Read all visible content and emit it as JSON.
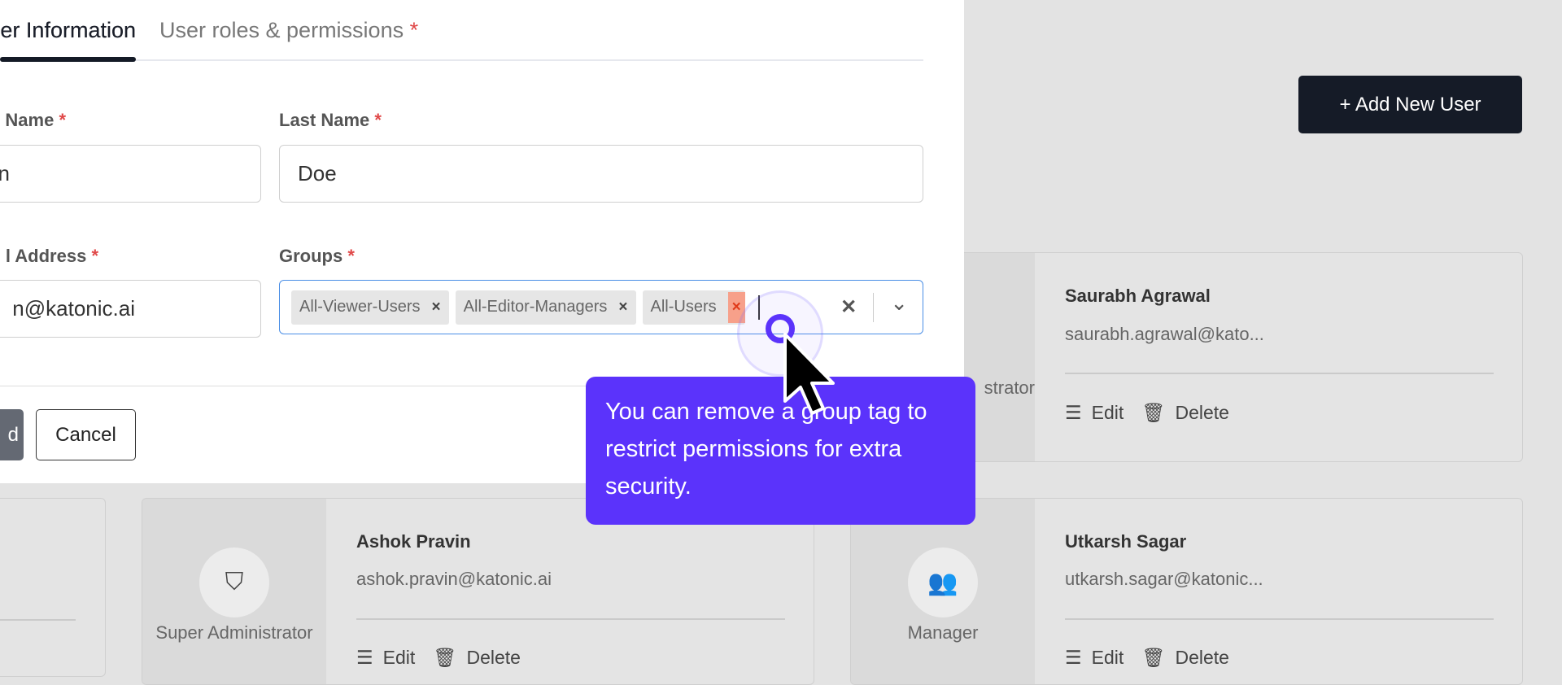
{
  "modal": {
    "tabs": [
      {
        "label": "User Information",
        "visible_label": "er Information"
      },
      {
        "label": "User roles & permissions",
        "required": "*"
      }
    ],
    "fields": {
      "first_name": {
        "label": "Name",
        "required": "*",
        "value": "hn"
      },
      "last_name": {
        "label": "Last Name",
        "required": "*",
        "value": "Doe"
      },
      "email": {
        "label": "l Address",
        "required": "*",
        "value": "n@katonic.ai"
      },
      "groups": {
        "label": "Groups",
        "required": "*",
        "tags": [
          "All-Viewer-Users",
          "All-Editor-Managers",
          "All-Users"
        ],
        "remove": "×",
        "clear": "✕",
        "chevron": "⌄"
      }
    },
    "save_label": "d",
    "cancel_label": "Cancel"
  },
  "header": {
    "add_user_label": "+ Add New User"
  },
  "cards": [
    {
      "name": "Saurabh Agrawal",
      "email": "saurabh.agrawal@kato...",
      "role": "strator",
      "edit": "Edit",
      "delete": "Delete"
    },
    {
      "name": "Ashok Pravin",
      "email": "ashok.pravin@katonic.ai",
      "role": "Super Administrator",
      "edit": "Edit",
      "delete": "Delete"
    },
    {
      "name": "Utkarsh Sagar",
      "email": "utkarsh.sagar@katonic...",
      "role": "Manager",
      "edit": "Edit",
      "delete": "Delete"
    }
  ],
  "tooltip": {
    "text": "You can remove a group tag to restrict permissions for extra security."
  },
  "colors": {
    "accent": "#5b33fb",
    "primary_button": "#151b27"
  }
}
